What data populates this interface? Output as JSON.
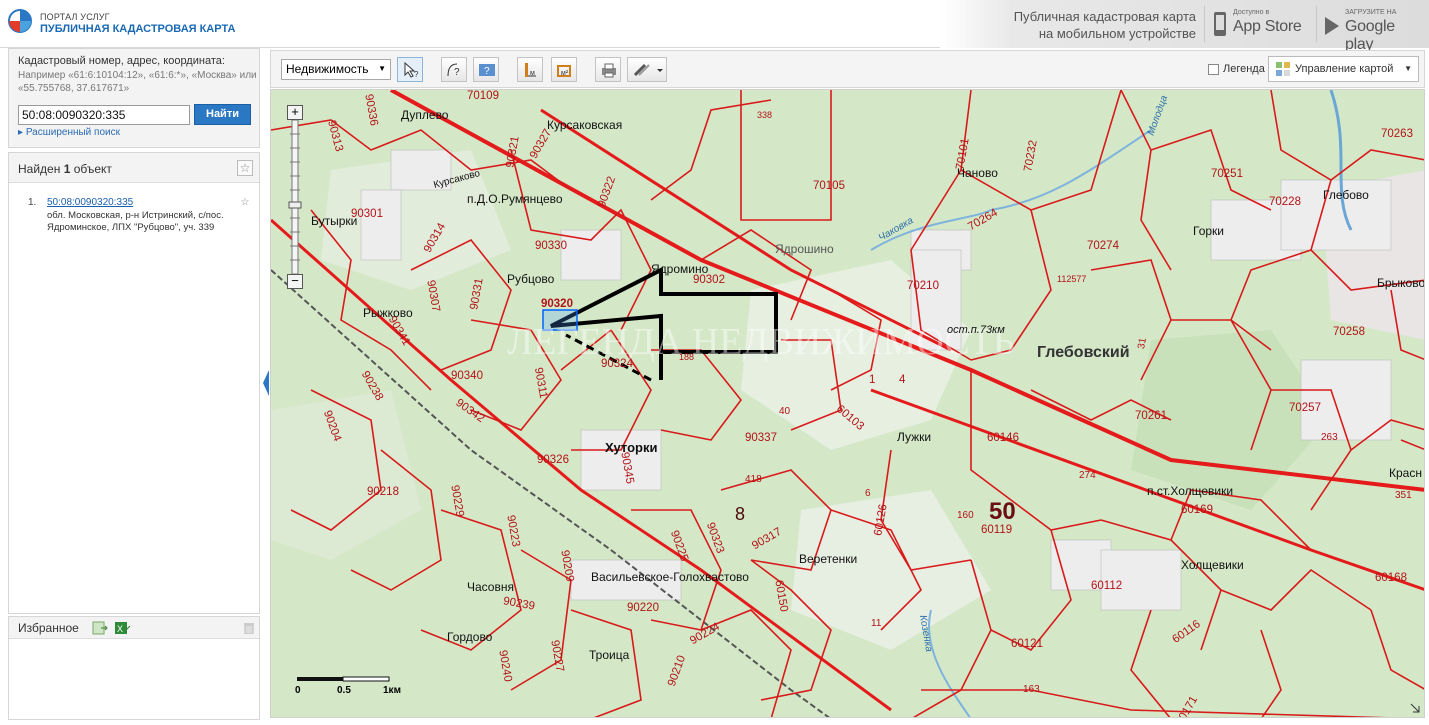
{
  "header": {
    "portal_small": "ПОРТАЛ УСЛУГ",
    "portal_big": "ПУБЛИЧНАЯ КАДАСТРОВАЯ КАРТА",
    "mobile_line1": "Публичная кадастровая карта",
    "mobile_line2": "на мобильном устройстве",
    "appstore_small": "Доступно в",
    "appstore_big": "App Store",
    "googleplay_small": "ЗАГРУЗИТЕ НА",
    "googleplay_big": "Google play"
  },
  "search": {
    "title": "Кадастровый номер, адрес, координата:",
    "hint": "Например «61:6:10104:12», «61:6:*», «Москва» или «55.755768, 37.617671»",
    "value": "50:08:0090320:335",
    "button": "Найти",
    "advanced": "Расширенный поиск"
  },
  "results": {
    "title_prefix": "Найден ",
    "count": "1",
    "title_suffix": " объект",
    "items": [
      {
        "num": "1.",
        "link": "50:08:0090320:335",
        "address": "обл. Московская, р-н Истринский, с/пос. Ядроминское, ЛПХ \"Рубцово\", уч. 339"
      }
    ]
  },
  "favorites": {
    "title": "Избранное"
  },
  "toolbar": {
    "type_select": "Недвижимость",
    "legend_label": "Легенда",
    "map_control": "Управление картой"
  },
  "map": {
    "scale_labels": [
      "0",
      "0.5",
      "1км"
    ],
    "watermark": "ЛЕГЕНДА НЕДВИЖИМОСТЬ",
    "parcel_labels": [
      "90313",
      "90336",
      "90301",
      "90314",
      "90307",
      "90341",
      "90238",
      "90204",
      "90218",
      "90229",
      "90223",
      "90239",
      "90240",
      "90227",
      "90209",
      "90220",
      "90210",
      "90224",
      "90225",
      "90323",
      "90317",
      "60150",
      "90326",
      "90345",
      "90340",
      "90342",
      "90311",
      "90331",
      "90330",
      "90321",
      "90327",
      "90322",
      "90324",
      "90302",
      "90337",
      "60103",
      "60126",
      "60119",
      "60146",
      "60112",
      "60116",
      "60121",
      "60171",
      "60168",
      "70109",
      "70105",
      "70101",
      "70232",
      "70264",
      "70210",
      "70274",
      "70251",
      "70228",
      "70263",
      "70258",
      "70257",
      "70261",
      "60169",
      "90320",
      "338",
      "112577",
      "188",
      "40",
      "418",
      "8",
      "6",
      "1",
      "4",
      "160",
      "274",
      "263",
      "351",
      "31",
      "11",
      "163",
      "50"
    ],
    "places": [
      "Дуплево",
      "Курсаково",
      "Курсаковская",
      "п.Д.О.Румянцево",
      "Бутырки",
      "Рубцово",
      "Рыжково",
      "Ядромино",
      "Ядрошино",
      "Чаново",
      "Горки",
      "Глебово",
      "Брыково",
      "Глебовский",
      "ост.п.73км",
      "Лужки",
      "Хуторки",
      "Веретенки",
      "Васильевское-Голохвастово",
      "Часовня",
      "Гордово",
      "Троица",
      "п.ст.Холщевики",
      "Холщевики",
      "Красн",
      "Чаковка",
      "Козенка",
      "Молодца"
    ]
  }
}
